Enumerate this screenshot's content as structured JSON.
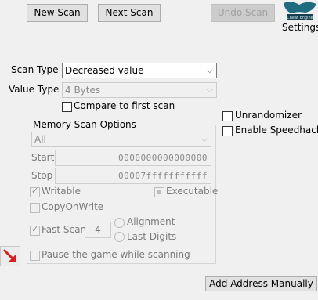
{
  "toolbar": {
    "new_scan": "New Scan",
    "next_scan": "Next Scan",
    "undo_scan": "Undo Scan",
    "settings": "Settings",
    "logo_text": "Cheat Engine"
  },
  "scan_type": {
    "label": "Scan Type",
    "value": "Decreased value"
  },
  "value_type": {
    "label": "Value Type",
    "value": "4 Bytes"
  },
  "compare_first": {
    "label": "Compare to first scan",
    "checked": false
  },
  "unrandomizer": {
    "label": "Unrandomizer",
    "checked": false
  },
  "speedhack": {
    "label": "Enable Speedhack",
    "checked": false
  },
  "memory_options": {
    "title": "Memory Scan Options",
    "region": "All",
    "start_label": "Start",
    "start_value": "0000000000000000",
    "stop_label": "Stop",
    "stop_value": "00007fffffffffff",
    "writable": "Writable",
    "executable": "Executable",
    "copy_on_write": "CopyOnWrite",
    "fast_scan": "Fast Scan",
    "fast_scan_value": "4",
    "alignment": "Alignment",
    "last_digits": "Last Digits",
    "pause_game": "Pause the game while scanning"
  },
  "add_address": "Add Address Manually",
  "colors": {
    "arrow": "#d42020",
    "logo": "#1f6b80"
  }
}
